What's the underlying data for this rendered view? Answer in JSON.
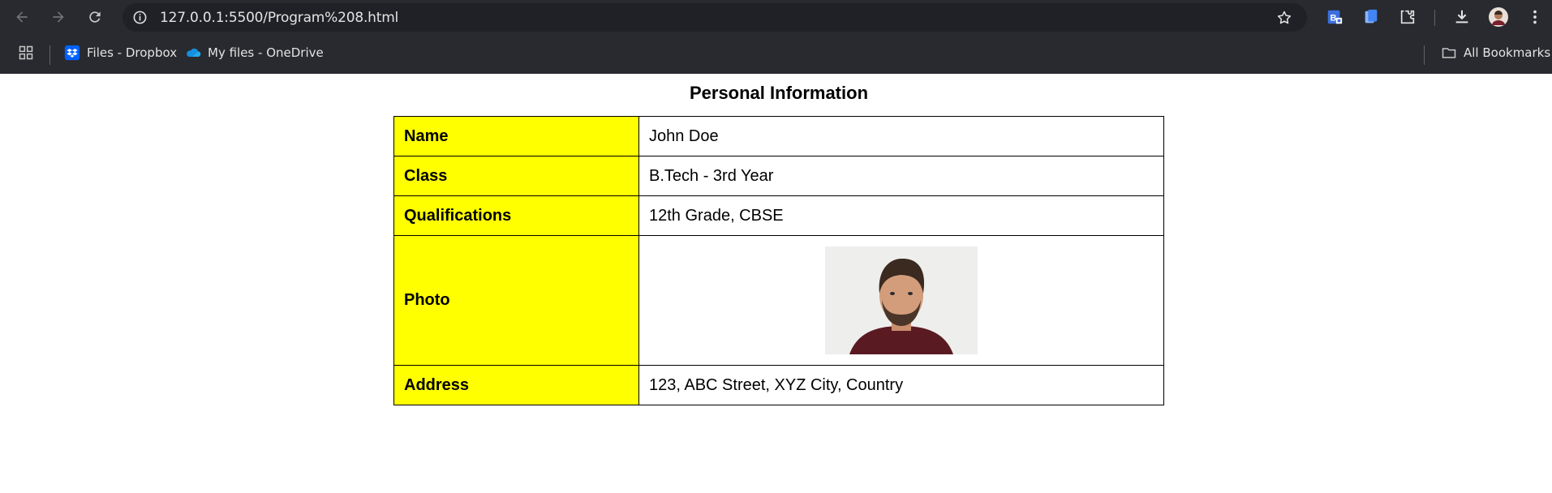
{
  "browser": {
    "url": "127.0.0.1:5500/Program%208.html",
    "bookmarks": [
      {
        "label": "Files - Dropbox",
        "icon": "dropbox-icon"
      },
      {
        "label": "My files - OneDrive",
        "icon": "onedrive-icon"
      }
    ],
    "all_bookmarks_label": "All Bookmarks"
  },
  "page": {
    "title": "Personal Information",
    "rows": [
      {
        "key": "Name",
        "value": "John Doe"
      },
      {
        "key": "Class",
        "value": "B.Tech - 3rd Year"
      },
      {
        "key": "Qualifications",
        "value": "12th Grade, CBSE"
      },
      {
        "key": "Photo",
        "value": ""
      },
      {
        "key": "Address",
        "value": "123, ABC Street, XYZ City, Country"
      }
    ]
  },
  "colors": {
    "key_cell_bg": "#ffff00",
    "chrome_bg": "#282a2f",
    "omnibox_bg": "#1f2126"
  }
}
